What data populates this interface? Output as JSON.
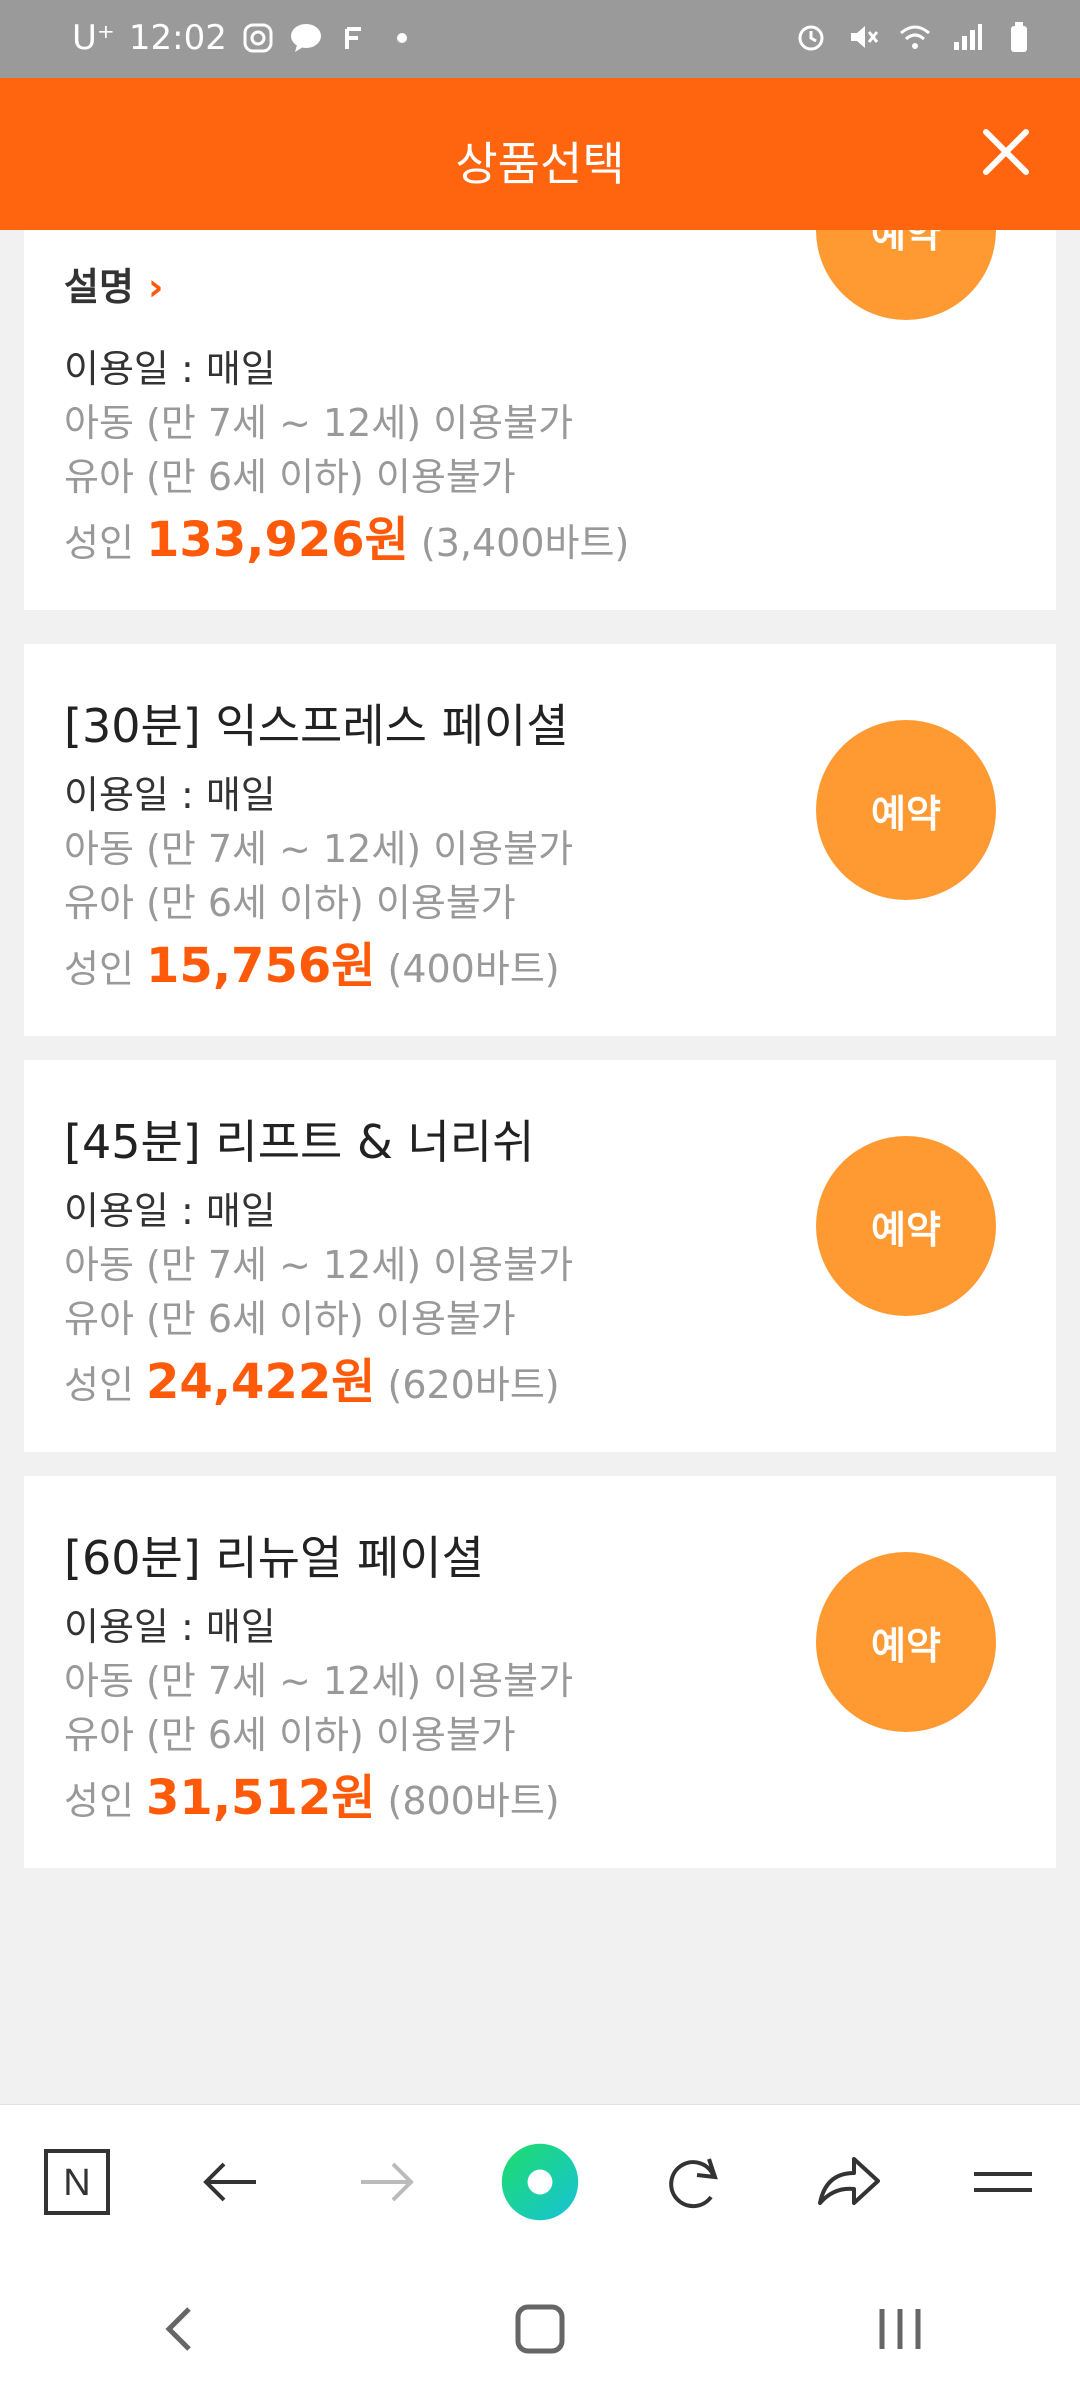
{
  "status_bar": {
    "carrier": "U⁺",
    "time": "12:02",
    "notification_icons": [
      "instagram-icon",
      "talk-icon",
      "f-icon",
      "dot-icon"
    ],
    "system_icons": [
      "alarm-icon",
      "mute-icon",
      "wifi-icon",
      "signal-icon",
      "battery-icon"
    ]
  },
  "header": {
    "title": "상품선택"
  },
  "first_card": {
    "desc_label": "설명",
    "usage": "이용일 : 매일",
    "child": "아동 (만 7세 ~ 12세) 이용불가",
    "infant": "유아 (만 6세 이하) 이용불가",
    "adult_label": "성인",
    "price": "133,926원",
    "baht": "(3,400바트)",
    "button": "예약"
  },
  "products": [
    {
      "title": "[30분] 익스프레스 페이셜",
      "usage": "이용일 : 매일",
      "child": "아동 (만 7세 ~ 12세) 이용불가",
      "infant": "유아 (만 6세 이하) 이용불가",
      "adult_label": "성인",
      "price": "15,756원",
      "baht": "(400바트)",
      "button": "예약"
    },
    {
      "title": "[45분] 리프트 & 너리쉬",
      "usage": "이용일 : 매일",
      "child": "아동 (만 7세 ~ 12세) 이용불가",
      "infant": "유아 (만 6세 이하) 이용불가",
      "adult_label": "성인",
      "price": "24,422원",
      "baht": "(620바트)",
      "button": "예약"
    },
    {
      "title": "[60분] 리뉴얼 페이셜",
      "usage": "이용일 : 매일",
      "child": "아동 (만 7세 ~ 12세) 이용불가",
      "infant": "유아 (만 6세 이하) 이용불가",
      "adult_label": "성인",
      "price": "31,512원",
      "baht": "(800바트)",
      "button": "예약"
    }
  ],
  "toolbar": {
    "home_letter": "N"
  },
  "colors": {
    "header": "#ff640f",
    "accent_price": "#ff5a0a",
    "reserve_button": "#ff9a33"
  }
}
